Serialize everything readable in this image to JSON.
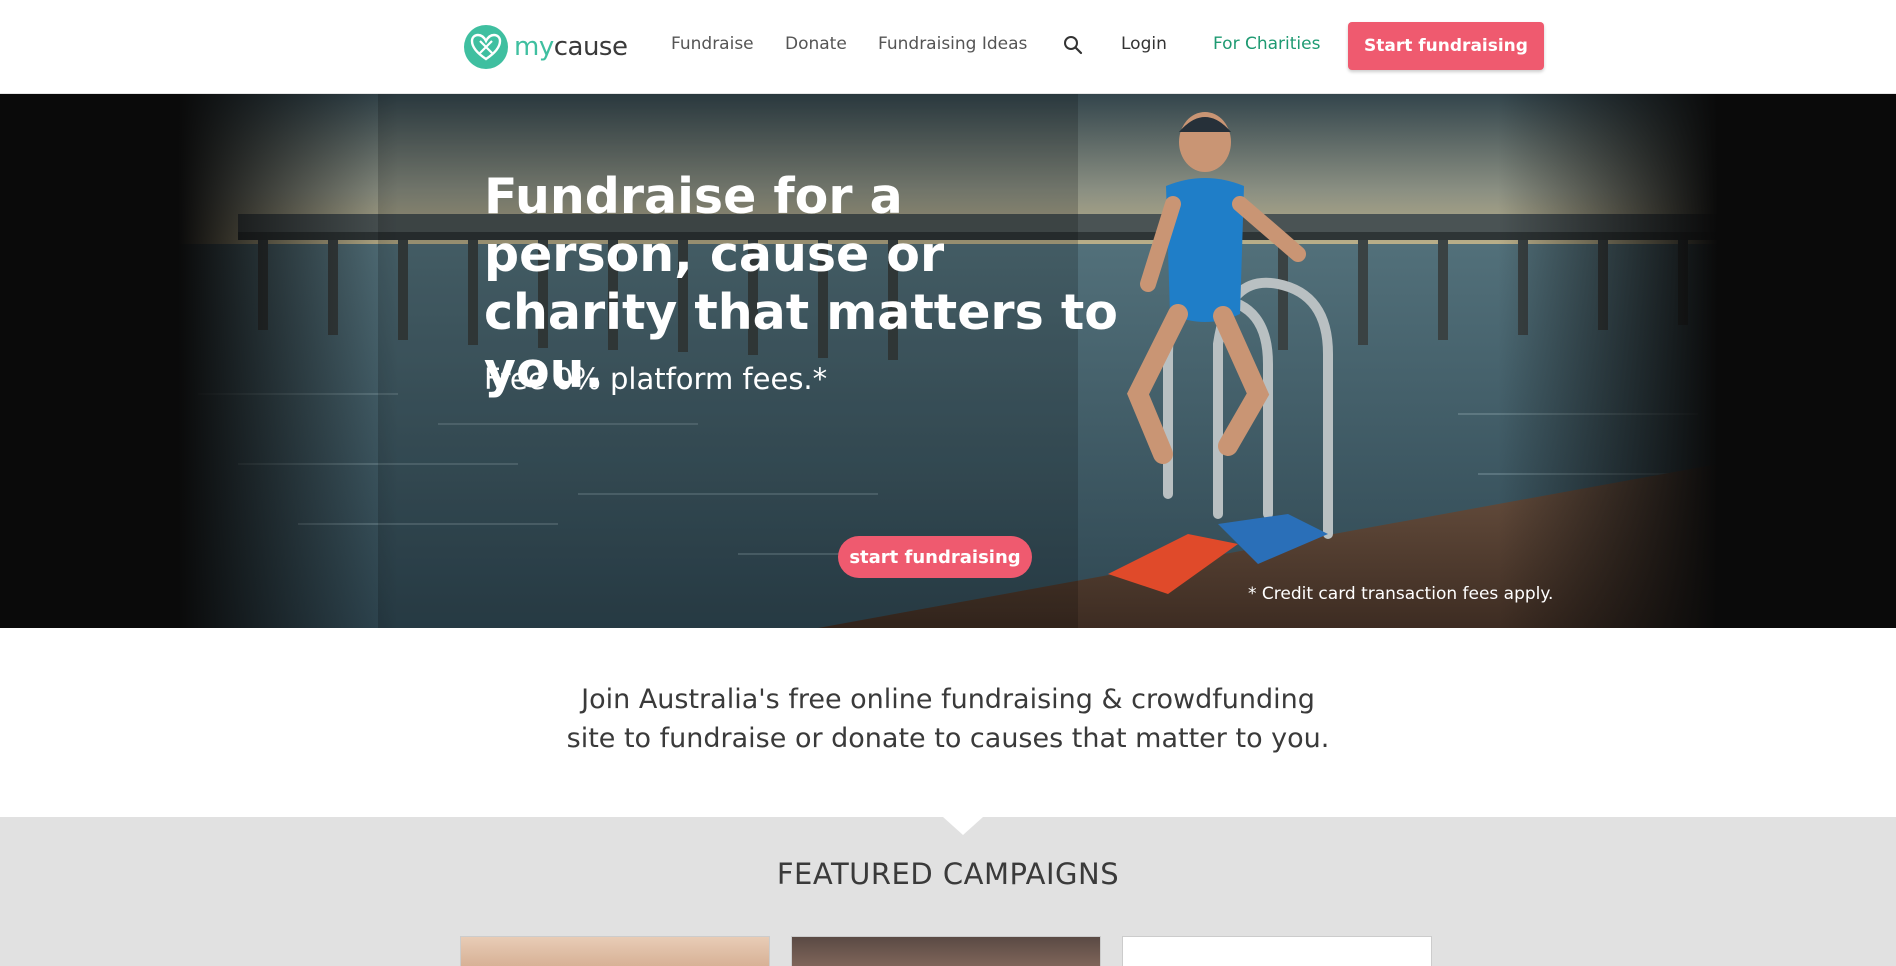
{
  "header": {
    "logo": {
      "my": "my",
      "cause": "cause"
    },
    "nav": [
      "Fundraise",
      "Donate",
      "Fundraising Ideas"
    ],
    "login": "Login",
    "for_charities": "For Charities",
    "start_button": "Start fundraising"
  },
  "hero": {
    "title": "Fundraise for a person, cause or charity that matters to you.",
    "subtitle": "Free 0% platform fees.*",
    "cta": "start fundraising",
    "note": "* Credit card transaction fees apply."
  },
  "intro": {
    "line1": "Join Australia's free online fundraising & crowdfunding",
    "line2": "site to fundraise or donate to causes that matter to you."
  },
  "featured": {
    "title": "FEATURED CAMPAIGNS"
  },
  "colors": {
    "brand_teal": "#3fbfa0",
    "accent_pink": "#ef5a6f",
    "charity_green": "#1e9a72",
    "featured_bg": "#e1e1e1"
  },
  "icons": {
    "search": "search-icon",
    "logo": "heart-logo-icon"
  }
}
